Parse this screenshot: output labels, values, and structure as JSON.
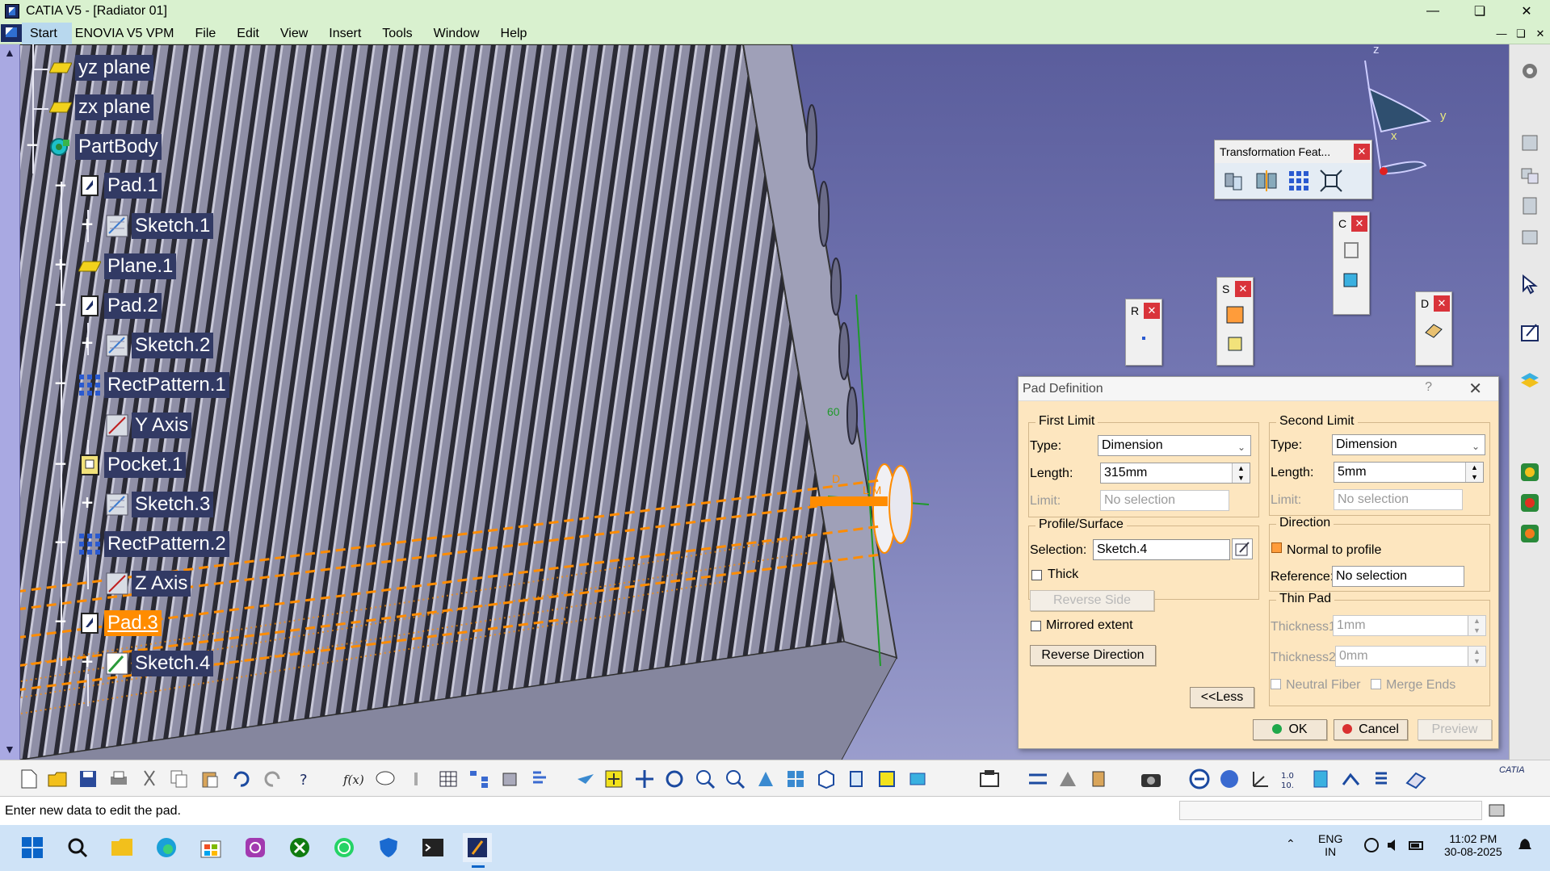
{
  "window": {
    "title": "CATIA V5 - [Radiator 01]",
    "minimize_icon": "minimize-icon",
    "maximize_icon": "restore-icon",
    "close_icon": "close-icon"
  },
  "menu": {
    "items": [
      "Start",
      "ENOVIA V5 VPM",
      "File",
      "Edit",
      "View",
      "Insert",
      "Tools",
      "Window",
      "Help"
    ],
    "active": "Start"
  },
  "tree": {
    "nodes": [
      {
        "label": "yz plane",
        "icon": "plane-icon"
      },
      {
        "label": "zx plane",
        "icon": "plane-icon"
      },
      {
        "label": "PartBody",
        "icon": "partbody-icon"
      },
      {
        "label": "Pad.1",
        "icon": "pad-icon"
      },
      {
        "label": "Sketch.1",
        "icon": "sketch-icon"
      },
      {
        "label": "Plane.1",
        "icon": "plane-icon"
      },
      {
        "label": "Pad.2",
        "icon": "pad-icon"
      },
      {
        "label": "Sketch.2",
        "icon": "sketch-icon"
      },
      {
        "label": "RectPattern.1",
        "icon": "rectpattern-icon"
      },
      {
        "label": "Y Axis",
        "icon": "axis-icon"
      },
      {
        "label": "Pocket.1",
        "icon": "pocket-icon"
      },
      {
        "label": "Sketch.3",
        "icon": "sketch-icon"
      },
      {
        "label": "RectPattern.2",
        "icon": "rectpattern-icon"
      },
      {
        "label": "Z Axis",
        "icon": "axis-icon"
      },
      {
        "label": "Pad.3",
        "icon": "pad-icon",
        "selected": true
      },
      {
        "label": "Sketch.4",
        "icon": "sketch-icon"
      }
    ]
  },
  "compass": {
    "x": "x",
    "y": "y",
    "z": "z"
  },
  "viewport_annotations": {
    "dim_60": "60",
    "dim_d": "D",
    "limit": "LIM"
  },
  "floating_toolbars": {
    "transformation": {
      "title": "Transformation Feat...",
      "icons": [
        "translate-icon",
        "mirror-icon",
        "rectangular-pattern-icon",
        "scale-icon"
      ]
    },
    "c_bar": {
      "title": "C",
      "icons": [
        "constraint-icon",
        "constraint-box-icon"
      ]
    },
    "s_bar": {
      "title": "S",
      "icons": [
        "sketch-based-pad-icon",
        "sketch-exit-icon"
      ]
    },
    "r_bar": {
      "title": "R",
      "icons": [
        "point-icon"
      ]
    },
    "d_bar": {
      "title": "D",
      "icons": [
        "dress-up-icon",
        "dress-up-2-icon"
      ]
    }
  },
  "pad_dialog": {
    "title": "Pad Definition",
    "help": "?",
    "close": "✕",
    "first_limit": {
      "title": "First Limit",
      "type_label": "Type:",
      "type_value": "Dimension",
      "length_label": "Length:",
      "length_value": "315mm",
      "limit_label": "Limit:",
      "limit_value": "No selection"
    },
    "profile": {
      "title": "Profile/Surface",
      "selection_label": "Selection:",
      "selection_value": "Sketch.4",
      "thick_label": "Thick",
      "reverse_side": "Reverse Side"
    },
    "mirrored_extent": "Mirrored extent",
    "reverse_direction": "Reverse Direction",
    "less": "<<Less",
    "second_limit": {
      "title": "Second Limit",
      "type_label": "Type:",
      "type_value": "Dimension",
      "length_label": "Length:",
      "length_value": "5mm",
      "limit_label": "Limit:",
      "limit_value": "No selection"
    },
    "direction": {
      "title": "Direction",
      "normal_label": "Normal to profile",
      "reference_label": "Reference:",
      "reference_value": "No selection"
    },
    "thin_pad": {
      "title": "Thin Pad",
      "thickness1_label": "Thickness1",
      "thickness1_value": "1mm",
      "thickness2_label": "Thickness2:",
      "thickness2_value": "0mm",
      "neutral_fiber": "Neutral Fiber",
      "merge_ends": "Merge Ends"
    },
    "ok": "OK",
    "cancel": "Cancel",
    "preview": "Preview",
    "colors": {
      "ok_dot": "#1fa84a",
      "cancel_dot": "#d93030"
    }
  },
  "bottom_toolbar": {
    "icons": [
      "new-icon",
      "open-icon",
      "save-icon",
      "print-icon",
      "cut-icon",
      "copy-icon",
      "paste-icon",
      "undo-icon",
      "redo-icon",
      "whats-this-icon",
      "formula-icon",
      "knowledge-icon",
      "touch-icon",
      "table-icon",
      "hierarchy-icon",
      "measure-icon",
      "analysis-icon",
      "fly-icon",
      "fit-all-icon",
      "pan-icon",
      "rotate-icon",
      "zoom-in-icon",
      "zoom-out-icon",
      "normal-view-icon",
      "multi-view-icon",
      "iso-view-icon",
      "shading-icon",
      "hide-show-icon",
      "swap-visible-icon",
      "sketcher-icon",
      "constraint-icon",
      "sketch-analysis-icon",
      "part-icon",
      "camera-icon",
      "update-icon",
      "render-icon",
      "axis-icon",
      "number-icon",
      "layer-icon",
      "sketch-tools-icon",
      "list-icon",
      "catalog-icon"
    ],
    "catia_logo": "CATIA"
  },
  "statusbar": {
    "message": "Enter new data to edit the pad."
  },
  "taskbar": {
    "icons": [
      "windows-start-icon",
      "search-icon",
      "file-explorer-icon",
      "edge-icon",
      "store-icon",
      "mail-icon",
      "xbox-icon",
      "whatsapp-icon",
      "defender-icon",
      "terminal-icon",
      "catia-taskbar-icon"
    ],
    "language_top": "ENG",
    "language_bottom": "IN",
    "time": "11:02 PM",
    "date": "30-08-2025"
  }
}
